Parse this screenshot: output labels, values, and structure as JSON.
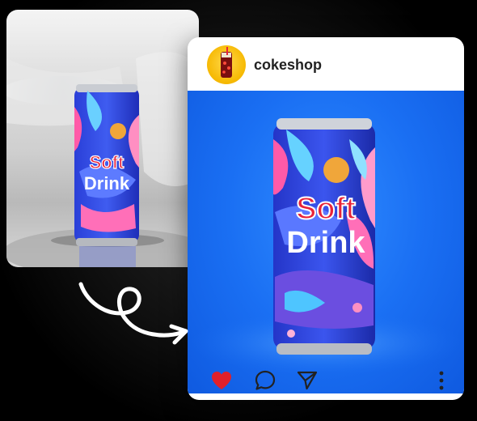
{
  "post": {
    "username": "cokeshop"
  },
  "product": {
    "label_line1": "Soft",
    "label_line2": "Drink"
  },
  "colors": {
    "like_red": "#e0202a",
    "background_blue": "#1a6ff3",
    "brand_text": "#e8233a"
  },
  "icons": {
    "like": "heart-icon",
    "comment": "comment-icon",
    "share": "send-icon",
    "more": "more-vertical-icon",
    "transition": "curved-arrow-icon"
  }
}
